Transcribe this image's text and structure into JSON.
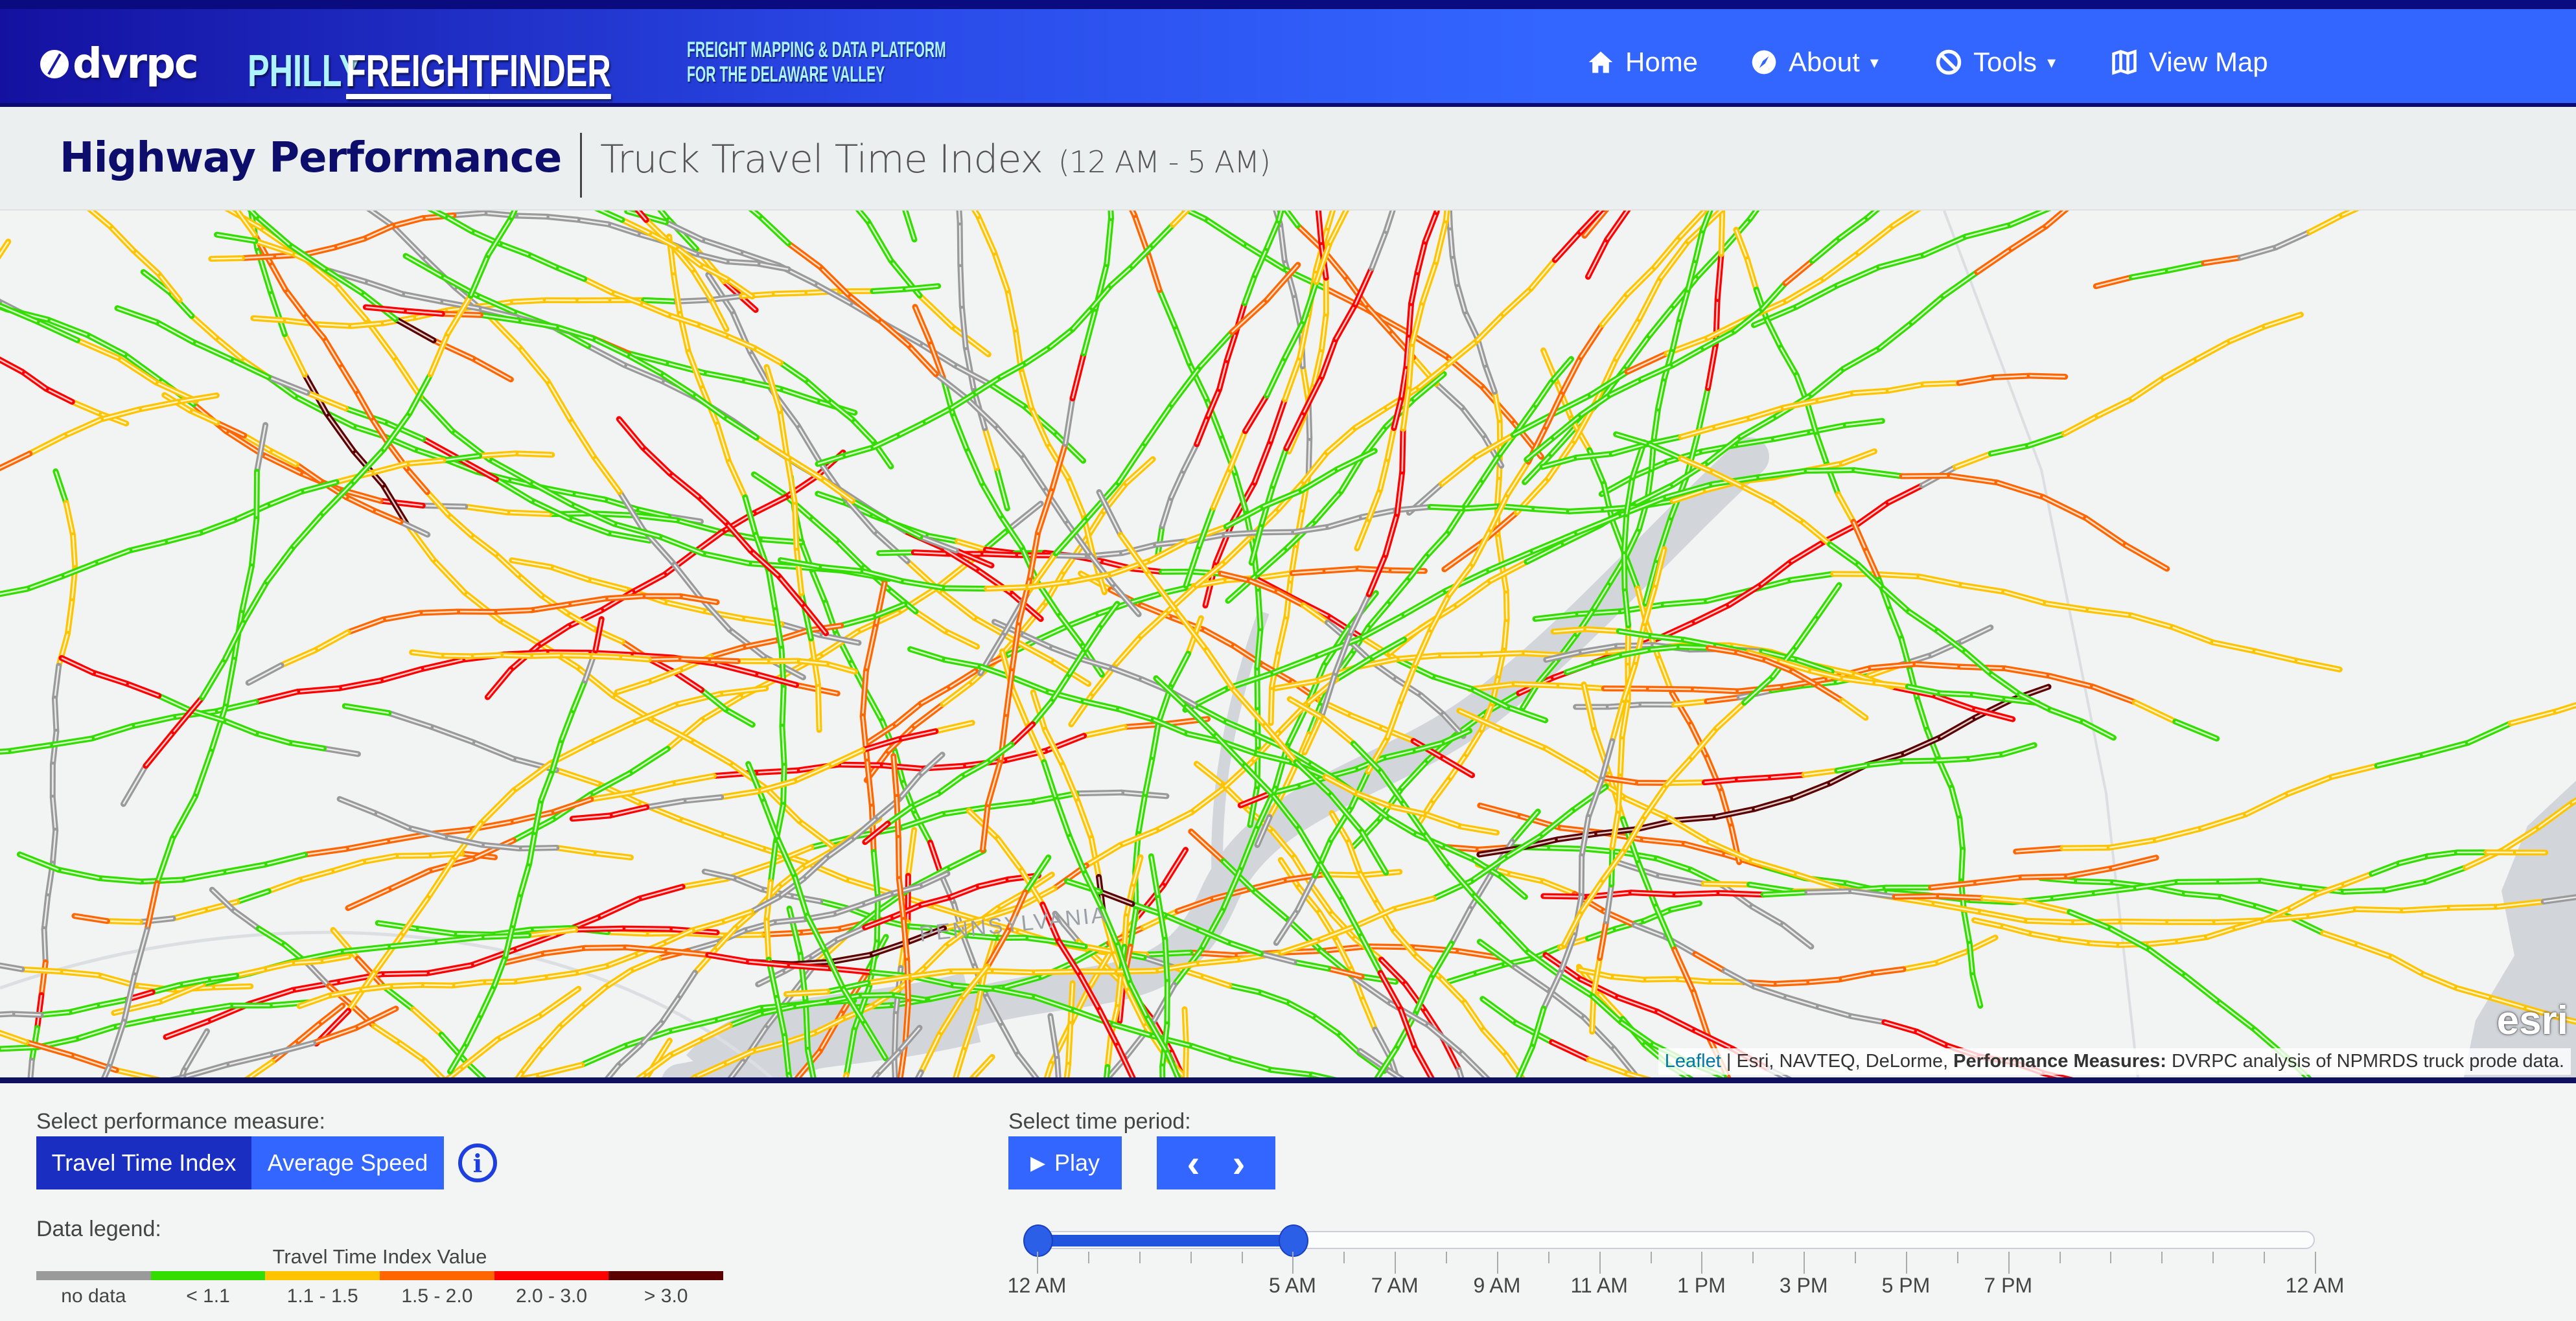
{
  "header": {
    "logo_text": "dvrpc",
    "brand_philly": "PHILLY",
    "brand_freight": "FREIGHT",
    "brand_finder": "FINDER",
    "tagline_line1": "FREIGHT MAPPING & DATA PLATFORM",
    "tagline_line2": "FOR THE DELAWARE VALLEY",
    "nav": [
      {
        "label": "Home",
        "icon": "home-icon"
      },
      {
        "label": "About",
        "icon": "compass-icon",
        "dropdown": true
      },
      {
        "label": "Tools",
        "icon": "ban-icon",
        "dropdown": true
      },
      {
        "label": "View Map",
        "icon": "map-icon"
      }
    ],
    "caret": "▾"
  },
  "titlebar": {
    "title": "Highway Performance",
    "subtitle": "Truck Travel Time Index",
    "period": "(12 AM - 5 AM)"
  },
  "map": {
    "state_label": "PENNSYLVANIA",
    "esri_logo": "esri",
    "attribution": {
      "leaflet": "Leaflet",
      "sep": " | ",
      "sources": "Esri, NAVTEQ, DeLorme, ",
      "measures_label": "Performance Measures:",
      "measures_text": " DVRPC analysis of NPMRDS truck prode data."
    },
    "colors": {
      "land": "#f2f3f3",
      "water": "#d2d6db",
      "boundary": "#dcdfe2"
    }
  },
  "controls": {
    "measure_label": "Select performance measure:",
    "measures": [
      {
        "label": "Travel Time Index",
        "active": true
      },
      {
        "label": "Average Speed",
        "active": false
      }
    ],
    "info_icon": "i",
    "time_label": "Select time period:",
    "play_label": "Play",
    "play_icon": "▶",
    "prev_icon": "‹",
    "next_icon": "›"
  },
  "legend": {
    "label": "Data legend:",
    "title": "Travel Time Index Value",
    "items": [
      {
        "label": "no data",
        "color": "#9a9a9a"
      },
      {
        "label": "< 1.1",
        "color": "#33dd00"
      },
      {
        "label": "1.1 - 1.5",
        "color": "#ffc400"
      },
      {
        "label": "1.5 - 2.0",
        "color": "#ff6600"
      },
      {
        "label": "2.0 - 3.0",
        "color": "#ff0000"
      },
      {
        "label": "> 3.0",
        "color": "#5a0000"
      }
    ]
  },
  "slider": {
    "min": 0,
    "max": 25,
    "selected": [
      0,
      5
    ],
    "labels": [
      {
        "value": 0,
        "text": "12 AM"
      },
      {
        "value": 5,
        "text": "5 AM"
      },
      {
        "value": 7,
        "text": "7 AM"
      },
      {
        "value": 9,
        "text": "9 AM"
      },
      {
        "value": 11,
        "text": "11 AM"
      },
      {
        "value": 13,
        "text": "1 PM"
      },
      {
        "value": 15,
        "text": "3 PM"
      },
      {
        "value": 17,
        "text": "5 PM"
      },
      {
        "value": 19,
        "text": "7 PM"
      },
      {
        "value": 25,
        "text": "12 AM"
      }
    ]
  }
}
